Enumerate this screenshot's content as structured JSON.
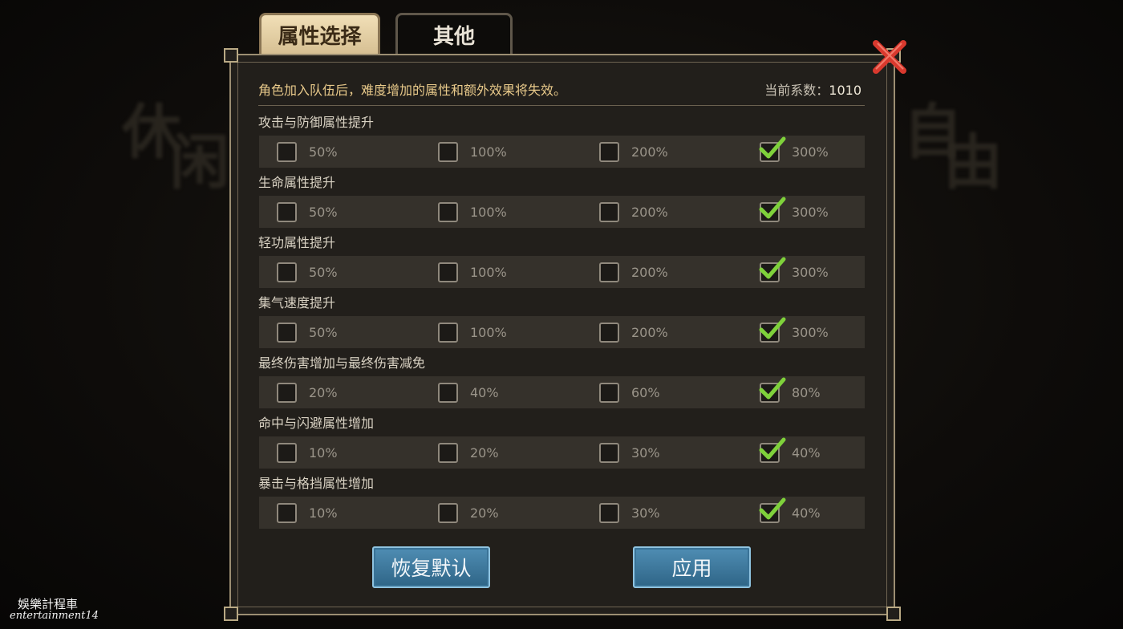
{
  "tabs": [
    {
      "label": "属性选择",
      "active": true
    },
    {
      "label": "其他",
      "active": false
    }
  ],
  "background_text": {
    "left": [
      "休",
      "闲"
    ],
    "right": [
      "自",
      "由"
    ]
  },
  "notice": "角色加入队伍后，难度增加的属性和额外效果将失效。",
  "coefficient": {
    "label": "当前系数：",
    "value": "1010"
  },
  "groups": [
    {
      "title": "攻击与防御属性提升",
      "options": [
        "50%",
        "100%",
        "200%",
        "300%"
      ],
      "selected_index": 3
    },
    {
      "title": "生命属性提升",
      "options": [
        "50%",
        "100%",
        "200%",
        "300%"
      ],
      "selected_index": 3
    },
    {
      "title": "轻功属性提升",
      "options": [
        "50%",
        "100%",
        "200%",
        "300%"
      ],
      "selected_index": 3
    },
    {
      "title": "集气速度提升",
      "options": [
        "50%",
        "100%",
        "200%",
        "300%"
      ],
      "selected_index": 3
    },
    {
      "title": "最终伤害增加与最终伤害减免",
      "options": [
        "20%",
        "40%",
        "60%",
        "80%"
      ],
      "selected_index": 3
    },
    {
      "title": "命中与闪避属性增加",
      "options": [
        "10%",
        "20%",
        "30%",
        "40%"
      ],
      "selected_index": 3
    },
    {
      "title": "暴击与格挡属性增加",
      "options": [
        "10%",
        "20%",
        "30%",
        "40%"
      ],
      "selected_index": 3
    }
  ],
  "buttons": {
    "reset_label": "恢复默认",
    "apply_label": "应用"
  },
  "watermark": {
    "line1": "娛樂計程車",
    "line2": "entertainment14"
  },
  "colors": {
    "accent_gold": "#e8c98a",
    "check_green": "#7fd13b",
    "close_red": "#d9392e",
    "button_blue": "#3f7ca3"
  }
}
